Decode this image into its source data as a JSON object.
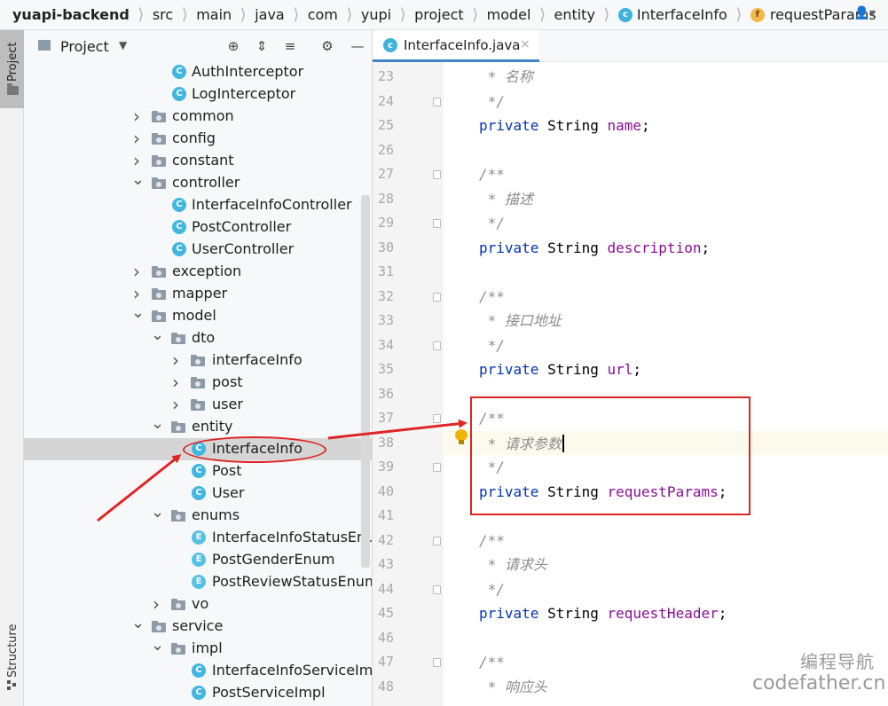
{
  "breadcrumb": {
    "items": [
      "yuapi-backend",
      "src",
      "main",
      "java",
      "com",
      "yupi",
      "project",
      "model",
      "entity",
      "InterfaceInfo",
      "requestParams"
    ],
    "class_badge": "c",
    "field_badge": "f"
  },
  "toolbar": {
    "user_menu_icon": "user-menu-icon"
  },
  "tool_stripe": {
    "project": "Project",
    "structure": "Structure"
  },
  "project_panel": {
    "title": "Project",
    "tree": [
      {
        "label": "AuthInterceptor",
        "kind": "class",
        "depth": 2
      },
      {
        "label": "LogInterceptor",
        "kind": "class",
        "depth": 2
      },
      {
        "label": "common",
        "kind": "folder",
        "depth": 1,
        "expanded": false
      },
      {
        "label": "config",
        "kind": "folder",
        "depth": 1,
        "expanded": false
      },
      {
        "label": "constant",
        "kind": "folder",
        "depth": 1,
        "expanded": false
      },
      {
        "label": "controller",
        "kind": "folder",
        "depth": 1,
        "expanded": true
      },
      {
        "label": "InterfaceInfoController",
        "kind": "class",
        "depth": 2
      },
      {
        "label": "PostController",
        "kind": "class",
        "depth": 2
      },
      {
        "label": "UserController",
        "kind": "class",
        "depth": 2
      },
      {
        "label": "exception",
        "kind": "folder",
        "depth": 1,
        "expanded": false
      },
      {
        "label": "mapper",
        "kind": "folder",
        "depth": 1,
        "expanded": false
      },
      {
        "label": "model",
        "kind": "folder",
        "depth": 1,
        "expanded": true
      },
      {
        "label": "dto",
        "kind": "folder",
        "depth": 2,
        "expanded": true
      },
      {
        "label": "interfaceInfo",
        "kind": "folder",
        "depth": 3,
        "expanded": false
      },
      {
        "label": "post",
        "kind": "folder",
        "depth": 3,
        "expanded": false
      },
      {
        "label": "user",
        "kind": "folder",
        "depth": 3,
        "expanded": false
      },
      {
        "label": "entity",
        "kind": "folder",
        "depth": 2,
        "expanded": true
      },
      {
        "label": "InterfaceInfo",
        "kind": "class",
        "depth": 3,
        "selected": true
      },
      {
        "label": "Post",
        "kind": "class",
        "depth": 3
      },
      {
        "label": "User",
        "kind": "class",
        "depth": 3
      },
      {
        "label": "enums",
        "kind": "folder",
        "depth": 2,
        "expanded": true
      },
      {
        "label": "InterfaceInfoStatusEnum",
        "kind": "enum",
        "depth": 3
      },
      {
        "label": "PostGenderEnum",
        "kind": "enum",
        "depth": 3
      },
      {
        "label": "PostReviewStatusEnum",
        "kind": "enum",
        "depth": 3
      },
      {
        "label": "vo",
        "kind": "folder",
        "depth": 2,
        "expanded": false
      },
      {
        "label": "service",
        "kind": "folder",
        "depth": 1,
        "expanded": true
      },
      {
        "label": "impl",
        "kind": "folder",
        "depth": 2,
        "expanded": true
      },
      {
        "label": "InterfaceInfoServiceImpl",
        "kind": "class",
        "depth": 3
      },
      {
        "label": "PostServiceImpl",
        "kind": "class",
        "depth": 3
      }
    ]
  },
  "editor": {
    "tab_label": "InterfaceInfo.java",
    "tab_close": "×",
    "lines": [
      {
        "n": "23",
        "tokens": [
          {
            "c": "cm",
            "t": " * 名称"
          }
        ]
      },
      {
        "n": "24",
        "tokens": [
          {
            "c": "cm",
            "t": " */"
          }
        ]
      },
      {
        "n": "25",
        "tokens": [
          {
            "c": "kw",
            "t": "private"
          },
          {
            "c": "ty",
            "t": " String "
          },
          {
            "c": "fd",
            "t": "name"
          },
          {
            "c": "pn",
            "t": ";"
          }
        ]
      },
      {
        "n": "26",
        "tokens": []
      },
      {
        "n": "27",
        "tokens": [
          {
            "c": "cm",
            "t": "/**"
          }
        ]
      },
      {
        "n": "28",
        "tokens": [
          {
            "c": "cm",
            "t": " * 描述"
          }
        ]
      },
      {
        "n": "29",
        "tokens": [
          {
            "c": "cm",
            "t": " */"
          }
        ]
      },
      {
        "n": "30",
        "tokens": [
          {
            "c": "kw",
            "t": "private"
          },
          {
            "c": "ty",
            "t": " String "
          },
          {
            "c": "fd",
            "t": "description"
          },
          {
            "c": "pn",
            "t": ";"
          }
        ]
      },
      {
        "n": "31",
        "tokens": []
      },
      {
        "n": "32",
        "tokens": [
          {
            "c": "cm",
            "t": "/**"
          }
        ]
      },
      {
        "n": "33",
        "tokens": [
          {
            "c": "cm",
            "t": " * 接口地址"
          }
        ]
      },
      {
        "n": "34",
        "tokens": [
          {
            "c": "cm",
            "t": " */"
          }
        ]
      },
      {
        "n": "35",
        "tokens": [
          {
            "c": "kw",
            "t": "private"
          },
          {
            "c": "ty",
            "t": " String "
          },
          {
            "c": "fd",
            "t": "url"
          },
          {
            "c": "pn",
            "t": ";"
          }
        ]
      },
      {
        "n": "36",
        "tokens": []
      },
      {
        "n": "37",
        "tokens": [
          {
            "c": "cm",
            "t": "/**"
          }
        ]
      },
      {
        "n": "38",
        "tokens": [
          {
            "c": "cm",
            "t": " * 请求参数"
          }
        ]
      },
      {
        "n": "39",
        "tokens": [
          {
            "c": "cm",
            "t": " */"
          }
        ]
      },
      {
        "n": "40",
        "tokens": [
          {
            "c": "kw",
            "t": "private"
          },
          {
            "c": "ty",
            "t": " String "
          },
          {
            "c": "fd",
            "t": "requestParams"
          },
          {
            "c": "pn",
            "t": ";"
          }
        ]
      },
      {
        "n": "41",
        "tokens": []
      },
      {
        "n": "42",
        "tokens": [
          {
            "c": "cm",
            "t": "/**"
          }
        ]
      },
      {
        "n": "43",
        "tokens": [
          {
            "c": "cm",
            "t": " * 请求头"
          }
        ]
      },
      {
        "n": "44",
        "tokens": [
          {
            "c": "cm",
            "t": " */"
          }
        ]
      },
      {
        "n": "45",
        "tokens": [
          {
            "c": "kw",
            "t": "private"
          },
          {
            "c": "ty",
            "t": " String "
          },
          {
            "c": "fd",
            "t": "requestHeader"
          },
          {
            "c": "pn",
            "t": ";"
          }
        ]
      },
      {
        "n": "46",
        "tokens": []
      },
      {
        "n": "47",
        "tokens": [
          {
            "c": "cm",
            "t": "/**"
          }
        ]
      },
      {
        "n": "48",
        "tokens": [
          {
            "c": "cm",
            "t": " * 响应头"
          }
        ]
      }
    ]
  },
  "watermark": {
    "cn": "编程导航",
    "en": "codefather.cn"
  },
  "colors": {
    "annotation_red": "#e02424",
    "keyword": "#0033b3",
    "field": "#871094",
    "comment": "#8c8c8c",
    "class_icon": "#40b6e0"
  }
}
